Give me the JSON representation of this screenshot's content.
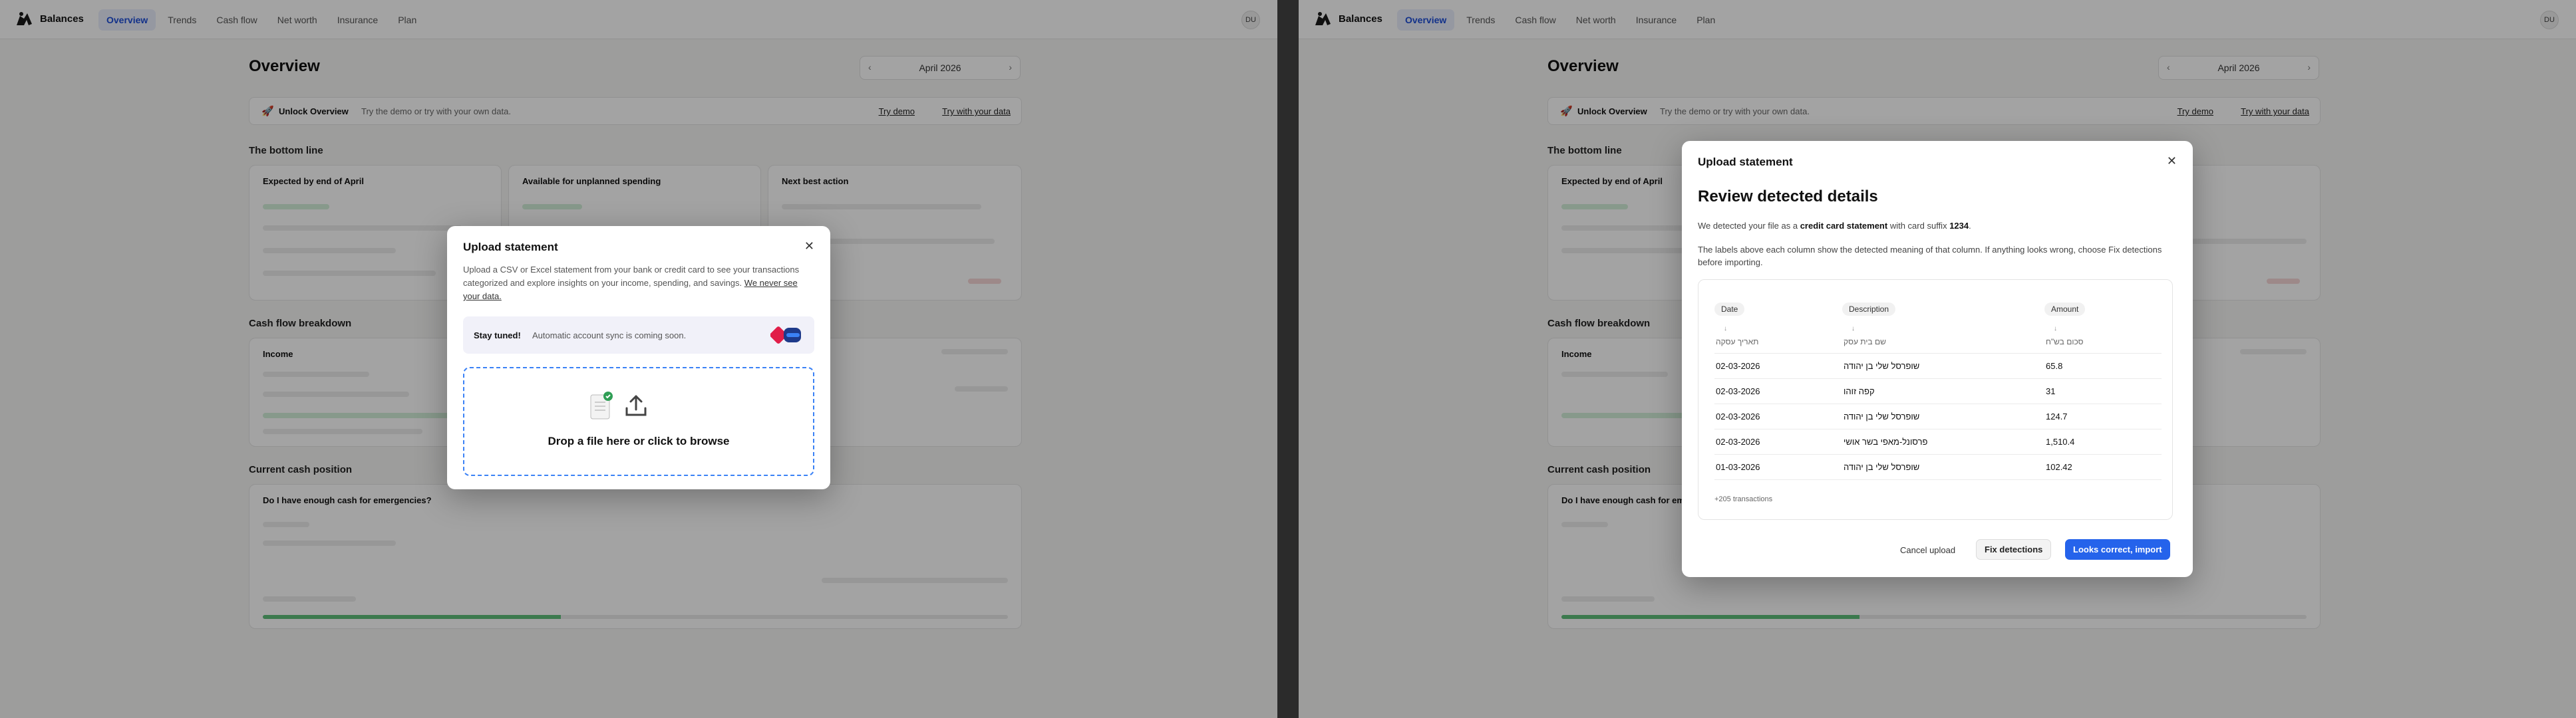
{
  "app": {
    "brand": "Balances",
    "nav": [
      "Overview",
      "Trends",
      "Cash flow",
      "Net worth",
      "Insurance",
      "Plan"
    ],
    "avatar": "DU"
  },
  "page": {
    "title": "Overview",
    "month": "April 2026",
    "banner": {
      "title": "Unlock Overview",
      "subtitle": "Try the demo or try with your own data.",
      "link_demo": "Try demo",
      "link_own": "Try with your data"
    },
    "sections": {
      "bottom_line": "The bottom line",
      "cash_flow": "Cash flow breakdown",
      "cash_position": "Current cash position"
    },
    "cards": {
      "expected": "Expected by end of April",
      "available": "Available for unplanned spending",
      "next_action": "Next best action",
      "income": "Income",
      "emergency": "Do I have enough cash for emergencies?"
    }
  },
  "upload_modal": {
    "title": "Upload statement",
    "description": "Upload a CSV or Excel statement from your bank or credit card to see your transactions categorized and explore insights on your income, spending, and savings.",
    "privacy_link": "We never see your data.",
    "stay_title": "Stay tuned!",
    "stay_text": "Automatic account sync is coming soon.",
    "drop_text": "Drop a file here or click to browse"
  },
  "review_modal": {
    "title": "Upload statement",
    "heading": "Review detected details",
    "detect_prefix": "We detected your file as a",
    "detect_type": "credit card statement",
    "detect_mid": "with card suffix",
    "card_suffix": "1234",
    "note": "The labels above each column show the detected meaning of that column. If anything looks wrong, choose Fix detections before importing.",
    "columns": [
      {
        "label": "Date",
        "header": "תאריך עסקה"
      },
      {
        "label": "Description",
        "header": "שם בית עסק"
      },
      {
        "label": "Amount",
        "header": "סכום בש\"ח"
      }
    ],
    "rows": [
      [
        "02-03-2026",
        "שופרסל שלי בן יהודה",
        "65.8"
      ],
      [
        "02-03-2026",
        "קפה זוהו",
        "31"
      ],
      [
        "02-03-2026",
        "שופרסל שלי בן יהודה",
        "124.7"
      ],
      [
        "02-03-2026",
        "פרסונל-מאפי בשר אושי",
        "1,510.4"
      ],
      [
        "01-03-2026",
        "שופרסל שלי בן יהודה",
        "102.42"
      ]
    ],
    "more": "+205 transactions",
    "cancel": "Cancel upload",
    "fix": "Fix detections",
    "import": "Looks correct, import"
  },
  "colors": {
    "accent": "#2563eb",
    "nav_active_bg": "#e9eefc",
    "positive": "#5fbf7a"
  }
}
